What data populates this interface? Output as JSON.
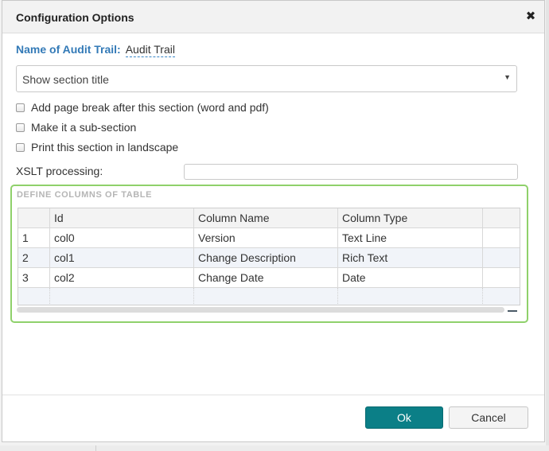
{
  "dialog": {
    "title": "Configuration Options",
    "close_icon": "close-icon"
  },
  "form": {
    "name_label": "Name of Audit Trail:",
    "name_value": "Audit Trail",
    "section_title_select": "Show section title",
    "checkboxes": [
      {
        "label": "Add page break after this section (word and pdf)",
        "checked": false
      },
      {
        "label": "Make it a sub-section",
        "checked": false
      },
      {
        "label": "Print this section in landscape",
        "checked": false
      }
    ],
    "xslt_label": "XSLT processing:",
    "xslt_value": ""
  },
  "table": {
    "heading": "DEFINE COLUMNS OF TABLE",
    "columns": [
      "",
      "Id",
      "Column Name",
      "Column Type",
      ""
    ],
    "rows": [
      [
        "1",
        "col0",
        "Version",
        "Text Line"
      ],
      [
        "2",
        "col1",
        "Change Description",
        "Rich Text"
      ],
      [
        "3",
        "col2",
        "Change Date",
        "Date"
      ]
    ]
  },
  "footer": {
    "ok_label": "Ok",
    "cancel_label": "Cancel"
  },
  "colors": {
    "accent_blue": "#337ab7",
    "ok_button": "#0b7f87",
    "table_border": "#8fd16b"
  }
}
